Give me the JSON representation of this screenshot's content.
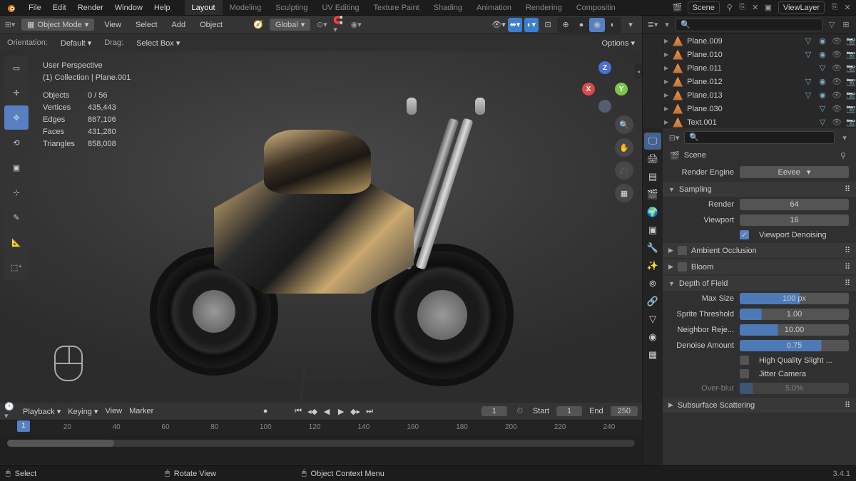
{
  "top_menu": {
    "items": [
      "File",
      "Edit",
      "Render",
      "Window",
      "Help"
    ]
  },
  "workspaces": [
    "Layout",
    "Modeling",
    "Sculpting",
    "UV Editing",
    "Texture Paint",
    "Shading",
    "Animation",
    "Rendering",
    "Compositin"
  ],
  "active_workspace": "Layout",
  "scene_name": "Scene",
  "viewlayer_name": "ViewLayer",
  "viewport": {
    "mode": "Object Mode",
    "menus": [
      "View",
      "Select",
      "Add",
      "Object"
    ],
    "orient": "Global",
    "orientation_label": "Orientation:",
    "orientation_value": "Default",
    "drag_label": "Drag:",
    "drag_value": "Select Box",
    "options": "Options"
  },
  "overlay": {
    "title": "User Perspective",
    "subtitle": "(1) Collection | Plane.001",
    "stats": [
      {
        "k": "Objects",
        "v": "0 / 56"
      },
      {
        "k": "Vertices",
        "v": "435,443"
      },
      {
        "k": "Edges",
        "v": "867,106"
      },
      {
        "k": "Faces",
        "v": "431,280"
      },
      {
        "k": "Triangles",
        "v": "858,008"
      }
    ]
  },
  "timeline": {
    "playback": "Playback",
    "keying": "Keying",
    "view": "View",
    "marker": "Marker",
    "cur": "1",
    "start_lbl": "Start",
    "start": "1",
    "end_lbl": "End",
    "end": "250",
    "ticks": [
      20,
      40,
      60,
      80,
      100,
      120,
      140,
      160,
      180,
      200,
      220,
      240
    ],
    "playhead": "1"
  },
  "status": {
    "select": "Select",
    "rotate": "Rotate View",
    "ctx": "Object Context Menu",
    "version": "3.4.1"
  },
  "outliner": [
    {
      "name": "Plane.009",
      "data": true,
      "mat": true
    },
    {
      "name": "Plane.010",
      "data": true,
      "mat": true
    },
    {
      "name": "Plane.011",
      "data": true,
      "mat": false
    },
    {
      "name": "Plane.012",
      "data": true,
      "mat": true
    },
    {
      "name": "Plane.013",
      "data": true,
      "mat": true
    },
    {
      "name": "Plane.030",
      "data": true,
      "mat": false
    },
    {
      "name": "Text.001",
      "data": true,
      "mat": false
    }
  ],
  "props": {
    "scene": "Scene",
    "engine_lbl": "Render Engine",
    "engine": "Eevee",
    "sampling": "Sampling",
    "render_lbl": "Render",
    "render": "64",
    "viewport_lbl": "Viewport",
    "viewport": "16",
    "denoise": "Viewport Denoising",
    "ao": "Ambient Occlusion",
    "bloom": "Bloom",
    "dof": "Depth of Field",
    "maxsize_lbl": "Max Size",
    "maxsize": "100 px",
    "sprite_lbl": "Sprite Threshold",
    "sprite": "1.00",
    "neigh_lbl": "Neighbor Reje...",
    "neigh": "10.00",
    "den_lbl": "Denoise Amount",
    "den": "0.75",
    "hq": "High Quality Slight ...",
    "jitter": "Jitter Camera",
    "over_lbl": "Over-blur",
    "over": "5.0%",
    "sss": "Subsurface Scattering"
  }
}
